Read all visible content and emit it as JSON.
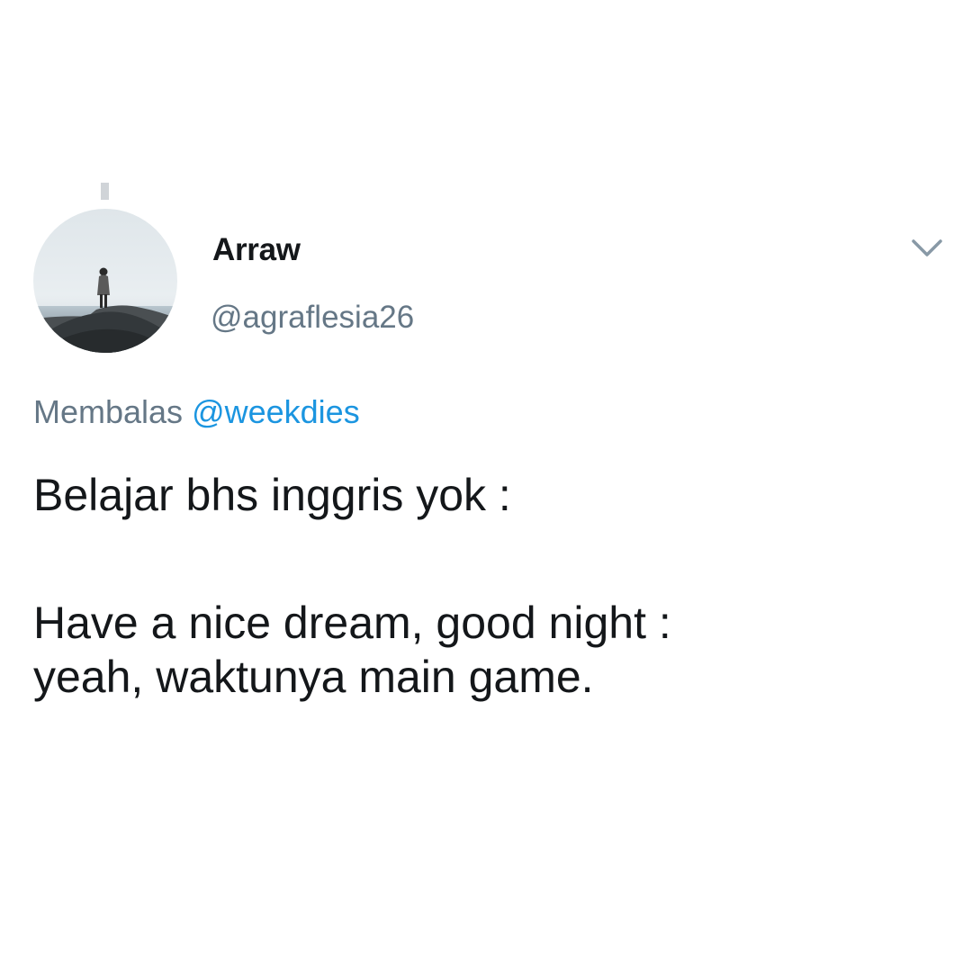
{
  "tweet": {
    "author": {
      "display_name": "Arraw",
      "handle": "@agraflesia26",
      "avatar_icon": "profile-photo-person-on-rock"
    },
    "reply": {
      "prefix": "Membalas",
      "mention": "@weekdies"
    },
    "text_lines": [
      "Belajar bhs inggris yok :",
      "Have a nice dream, good night :",
      "yeah, waktunya main game."
    ],
    "menu_icon": "chevron-down-icon"
  },
  "colors": {
    "background": "#ffffff",
    "text_primary": "#14171a",
    "text_secondary": "#657786",
    "link": "#1b95e0",
    "thread_line": "#d0d4d8"
  }
}
